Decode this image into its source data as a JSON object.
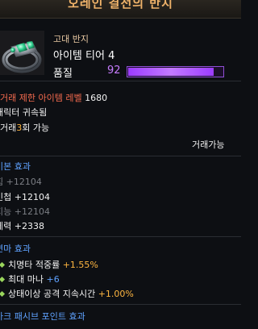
{
  "tooltip": {
    "title": "오레인 결전의 반지",
    "grade": "고대 반지",
    "tier": "아이템 티어 4",
    "quality_label": "품질",
    "quality_value": "92",
    "quality_fraction": 0.92,
    "requirement_prefix": "거래 제한 아이템 레벨",
    "requirement_value": "1680",
    "bind": "캐릭터 귀속됨",
    "trade_prefix": "거래",
    "trade_count": "3",
    "trade_suffix": "회 가능",
    "tradable": "거래가능"
  },
  "basic_effects": {
    "header": "기본 효과",
    "stats": [
      {
        "name": "힘",
        "value": "+12104",
        "active": false
      },
      {
        "name": "민첩",
        "value": "+12104",
        "active": true
      },
      {
        "name": "지능",
        "value": "+12104",
        "active": false
      },
      {
        "name": "체력",
        "value": "+2338",
        "active": true
      }
    ]
  },
  "refine_effects": {
    "header": "연마 효과",
    "items": [
      {
        "name": "치명타 적중률",
        "value": "+1.55%",
        "color": "#ffb640"
      },
      {
        "name": "최대 마나",
        "value": "+6",
        "color": "#5fa2ff"
      },
      {
        "name": "상태이상 공격 지속시간",
        "value": "+1.00%",
        "color": "#ffb640"
      }
    ]
  },
  "ark_passive": {
    "header": "아크 패시브 포인트 효과"
  }
}
